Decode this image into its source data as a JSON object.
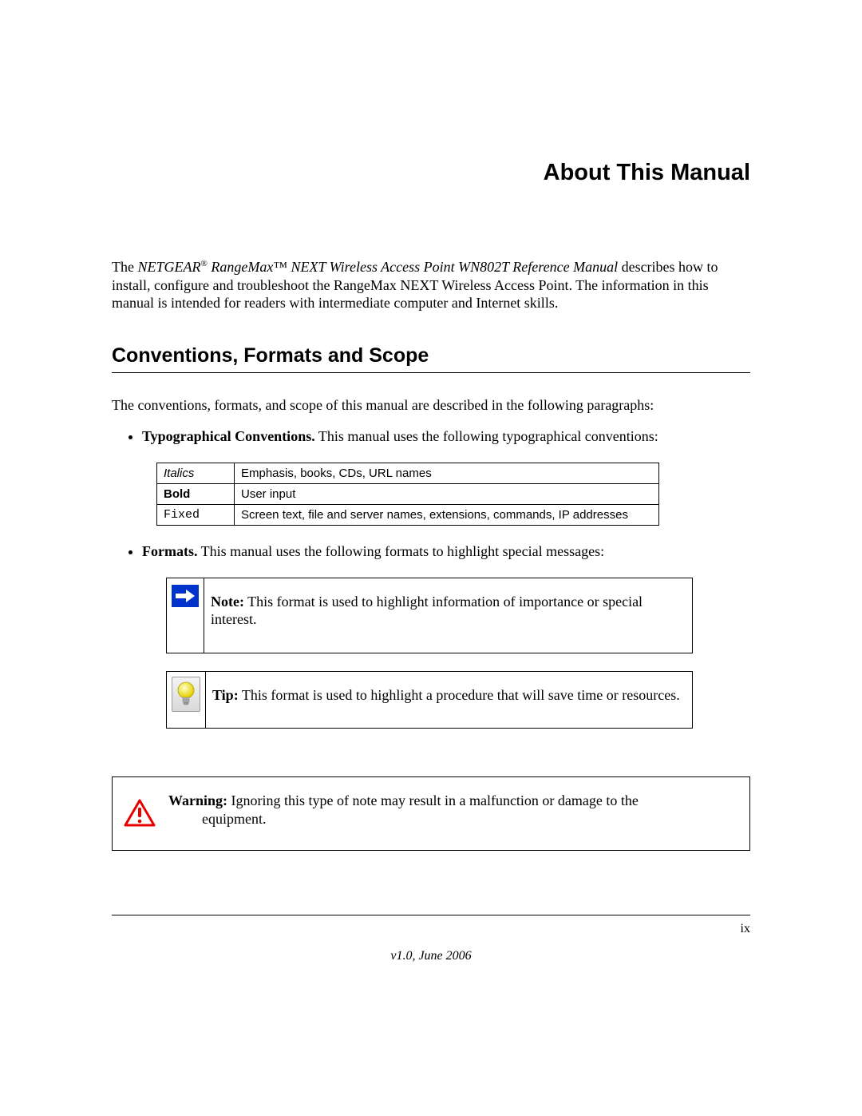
{
  "title": "About This Manual",
  "intro": {
    "prefix": "The ",
    "brand_pre": "NETGEAR",
    "reg": "®",
    "brand_post": " RangeMax™ NEXT Wireless Access Point WN802T Reference Manual",
    "rest": " describes how to install, configure and troubleshoot the RangeMax NEXT Wireless Access Point. The information in this manual is intended for readers with intermediate computer and Internet skills."
  },
  "section_heading": "Conventions, Formats and Scope",
  "section_intro": "The conventions, formats, and scope of this manual are described in the following paragraphs:",
  "bullet1_label": "Typographical Conventions.",
  "bullet1_text": " This manual uses the following typographical conventions:",
  "conv_table": [
    {
      "key": "Italics",
      "keyClass": "italic-cell",
      "desc": "Emphasis, books, CDs, URL names"
    },
    {
      "key": "Bold",
      "keyClass": "bold-cell",
      "desc": "User input"
    },
    {
      "key": "Fixed",
      "keyClass": "fixed-cell",
      "desc": "Screen text, file and server names, extensions, commands, IP addresses"
    }
  ],
  "bullet2_label": "Formats.",
  "bullet2_text": " This manual uses the following formats to highlight special messages:",
  "note": {
    "label": "Note:",
    "text": " This format is used to highlight information of importance or special interest."
  },
  "tip": {
    "label": "Tip:",
    "text": " This format is used to highlight a procedure that will save time or resources."
  },
  "warning": {
    "label": "Warning:",
    "text": " Ignoring this type of note may result in a malfunction or damage to the",
    "text2": "equipment."
  },
  "page_number": "ix",
  "version": "v1.0, June 2006"
}
